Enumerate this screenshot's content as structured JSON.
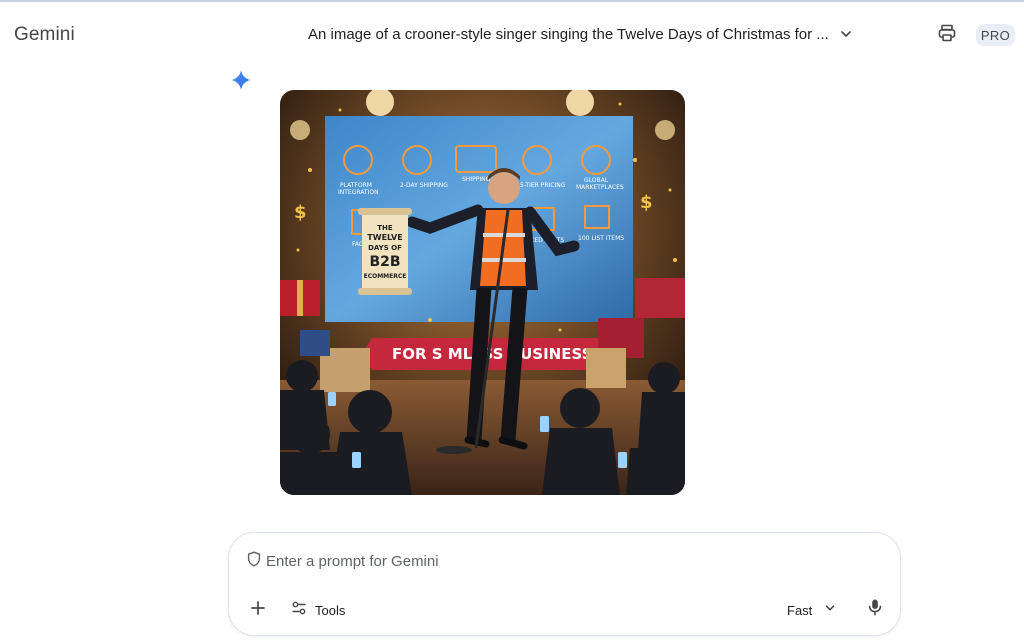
{
  "app": {
    "name": "Gemini"
  },
  "header": {
    "conversation_title": "An image of a crooner-style singer singing the Twelve Days of Christmas for ...",
    "badge": "PRO",
    "icons": {
      "title_menu": "chevron-down-icon",
      "print": "print-icon"
    }
  },
  "response": {
    "icon": "gemini-spark-icon",
    "image": {
      "scroll_lines": [
        "THE",
        "TWELVE",
        "DAYS OF",
        "B2B",
        "ECOMMERCE"
      ],
      "banner": "FOR S  MLESS  BUSINESS!",
      "screen_labels": [
        "PLATFORM INTEGRATION",
        "2-DAY SHIPPING",
        "2-DAY SHIPPING",
        "5-TIER PRICING",
        "GLOBAL MARKETPLACES",
        "FACE",
        "FIXED CARTS",
        "100 LIST ITEMS"
      ]
    }
  },
  "prompt": {
    "placeholder": "Enter a prompt for Gemini",
    "tools_label": "Tools",
    "mode_label": "Fast",
    "icons": {
      "shield": "shield-icon",
      "add": "plus-icon",
      "tools": "tools-icon",
      "mode": "chevron-down-icon",
      "mic": "mic-icon"
    }
  },
  "colors": {
    "accent": "#4285f4",
    "badge_bg": "#e9eef6",
    "prompt_border": "#dde3ea"
  }
}
